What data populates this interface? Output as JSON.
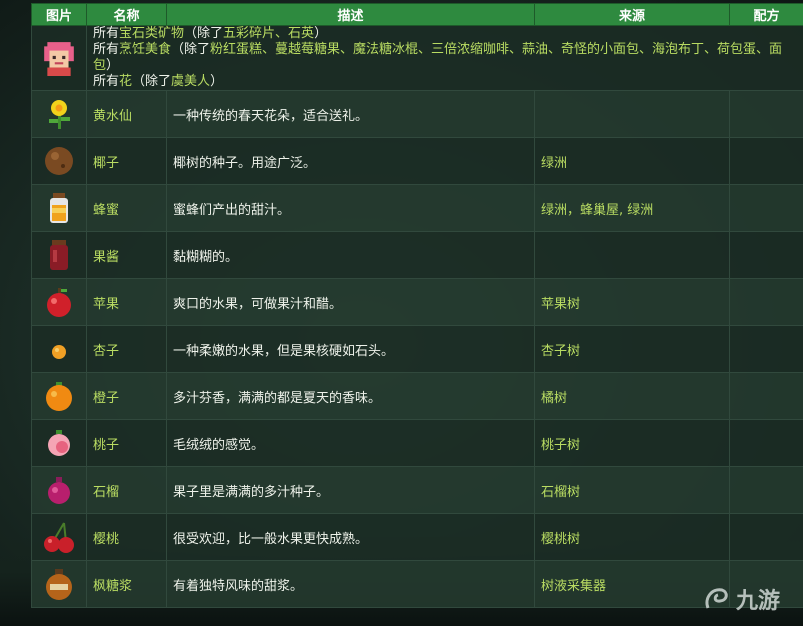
{
  "header": {
    "col_image": "图片",
    "col_name": "名称",
    "col_desc": "描述",
    "col_source": "来源",
    "col_recipe": "配方"
  },
  "top_row": {
    "line1_pre": "所有",
    "line1_link": "宝石类矿物",
    "line1_mid": "（除了",
    "line1_ex": "五彩碎片、石英",
    "line1_post": "）",
    "line2_pre": "所有",
    "line2_link": "烹饪美食",
    "line2_mid": "（除了",
    "line2_ex": "粉红蛋糕、蔓越莓糖果、魔法糖冰棍、三倍浓缩咖啡、蒜油、奇怪的小面包、海泡布丁、荷包蛋、面包",
    "line2_post": "）",
    "line3_pre": "所有",
    "line3_link": "花",
    "line3_mid": "（除了",
    "line3_ex": "虞美人",
    "line3_post": "）"
  },
  "rows": [
    {
      "icon": "daffodil-icon",
      "name": "黄水仙",
      "desc": "一种传统的春天花朵，适合送礼。",
      "source": "",
      "recipe": ""
    },
    {
      "icon": "coconut-icon",
      "name": "椰子",
      "desc": "椰树的种子。用途广泛。",
      "source": "绿洲",
      "recipe": ""
    },
    {
      "icon": "honey-icon",
      "name": "蜂蜜",
      "desc": "蜜蜂们产出的甜汁。",
      "source": "绿洲，蜂巢屋, 绿洲",
      "recipe": ""
    },
    {
      "icon": "jelly-icon",
      "name": "果酱",
      "desc": "黏糊糊的。",
      "source": "",
      "recipe": ""
    },
    {
      "icon": "apple-icon",
      "name": "苹果",
      "desc": "爽口的水果，可做果汁和醋。",
      "source": "苹果树",
      "recipe": ""
    },
    {
      "icon": "apricot-icon",
      "name": "杏子",
      "desc": "一种柔嫩的水果，但是果核硬如石头。",
      "source": "杏子树",
      "recipe": ""
    },
    {
      "icon": "orange-icon",
      "name": "橙子",
      "desc": "多汁芬香，满满的都是夏天的香味。",
      "source": "橘树",
      "recipe": ""
    },
    {
      "icon": "peach-icon",
      "name": "桃子",
      "desc": "毛绒绒的感觉。",
      "source": "桃子树",
      "recipe": ""
    },
    {
      "icon": "pomegranate-icon",
      "name": "石榴",
      "desc": "果子里是满满的多汁种子。",
      "source": "石榴树",
      "recipe": ""
    },
    {
      "icon": "cherry-icon",
      "name": "樱桃",
      "desc": "很受欢迎，比一般水果更快成熟。",
      "source": "樱桃树",
      "recipe": ""
    },
    {
      "icon": "maple-syrup-icon",
      "name": "枫糖浆",
      "desc": "有着独特风味的甜浆。",
      "source": "树液采集器",
      "recipe": ""
    }
  ],
  "watermark": {
    "text": "九游"
  },
  "colors": {
    "header": "#2e8a3f",
    "link": "#b9dc62",
    "row": "#1b2c24"
  }
}
